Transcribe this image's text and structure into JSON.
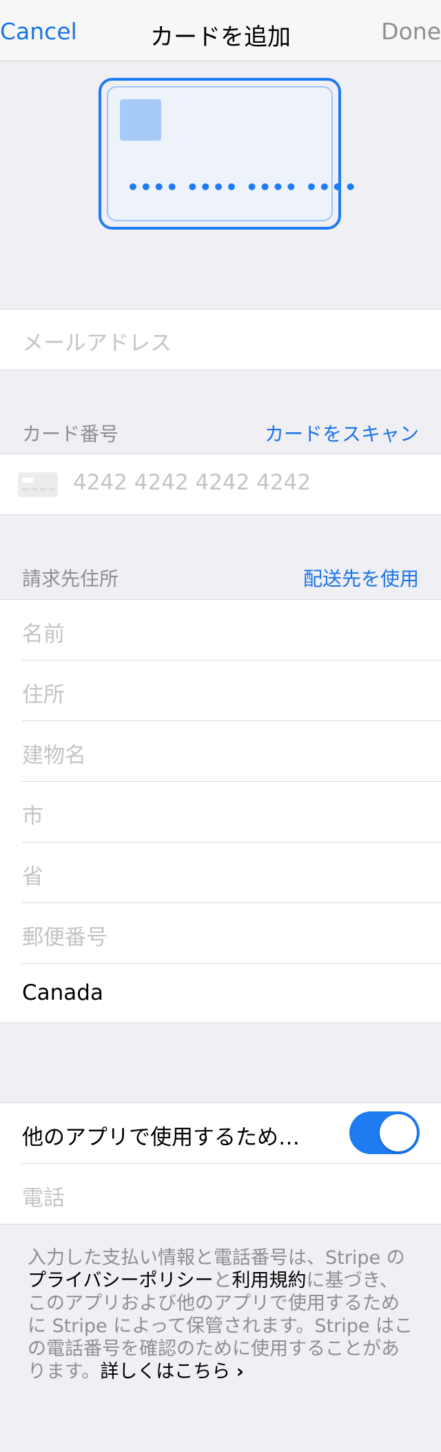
{
  "nav": {
    "cancel": "Cancel",
    "title": "カードを追加",
    "done": "Done"
  },
  "card_preview": {
    "number_mask": "•••• •••• •••• ••••"
  },
  "email": {
    "placeholder": "メールアドレス"
  },
  "card_section": {
    "label": "カード番号",
    "scan_link": "カードをスキャン",
    "number_placeholder": "4242 4242 4242 4242"
  },
  "billing": {
    "label": "請求先住所",
    "use_shipping_link": "配送先を使用",
    "fields": {
      "name": "名前",
      "address": "住所",
      "building": "建物名",
      "city": "市",
      "province": "省",
      "postal": "郵便番号",
      "country": "Canada"
    }
  },
  "save": {
    "label": "他のアプリで使用するため…",
    "enabled": true,
    "phone_placeholder": "電話"
  },
  "footer": {
    "text1": "入力した支払い情報と電話番号は、Stripe の",
    "privacy_link": "プライバシーポリシー",
    "text2": "と",
    "terms_link": "利用規約",
    "text3": "に基づき、このアプリおよび他のアプリで使用するために Stripe によって保管されます。Stripe はこの電話番号を確認のために使用することがあります。",
    "more_link": "詳しくはこちら",
    "chevron": "›"
  },
  "colors": {
    "accent": "#1f7bf2",
    "link": "#1a73e8",
    "background": "#efeff4"
  }
}
